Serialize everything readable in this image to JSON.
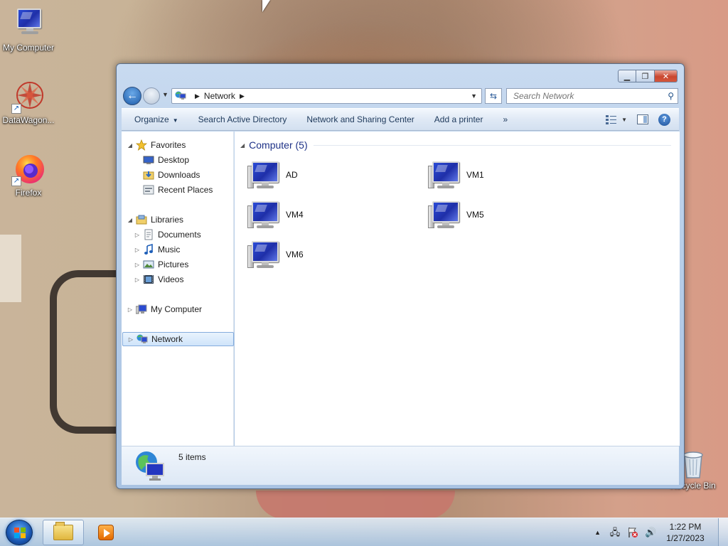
{
  "desktop": {
    "icons": [
      {
        "label": "My Computer",
        "icon": "my-computer-icon"
      },
      {
        "label": "DataWagon...",
        "icon": "datawagon-icon"
      },
      {
        "label": "Firefox",
        "icon": "firefox-icon"
      },
      {
        "label": "Recycle Bin",
        "icon": "recycle-bin-icon"
      }
    ]
  },
  "window": {
    "address": {
      "location": "Network",
      "location_icon": "network-icon"
    },
    "search": {
      "placeholder": "Search Network"
    },
    "commands": {
      "organize": "Organize",
      "search_ad": "Search Active Directory",
      "sharing_center": "Network and Sharing Center",
      "add_printer": "Add a printer",
      "more": "»"
    },
    "nav": {
      "favorites": "Favorites",
      "desktop": "Desktop",
      "downloads": "Downloads",
      "recent_places": "Recent Places",
      "libraries": "Libraries",
      "documents": "Documents",
      "music": "Music",
      "pictures": "Pictures",
      "videos": "Videos",
      "my_computer": "My Computer",
      "network": "Network"
    },
    "content": {
      "group_title": "Computer (5)",
      "computers": [
        "AD",
        "VM1",
        "VM4",
        "VM5",
        "VM6"
      ]
    },
    "details": {
      "item_count": "5 items"
    }
  },
  "taskbar": {
    "time": "1:22 PM",
    "date": "1/27/2023"
  },
  "colors": {
    "accent": "#1e3287",
    "selection": "#cfe4fa",
    "taskbar": "#aac8e6"
  }
}
